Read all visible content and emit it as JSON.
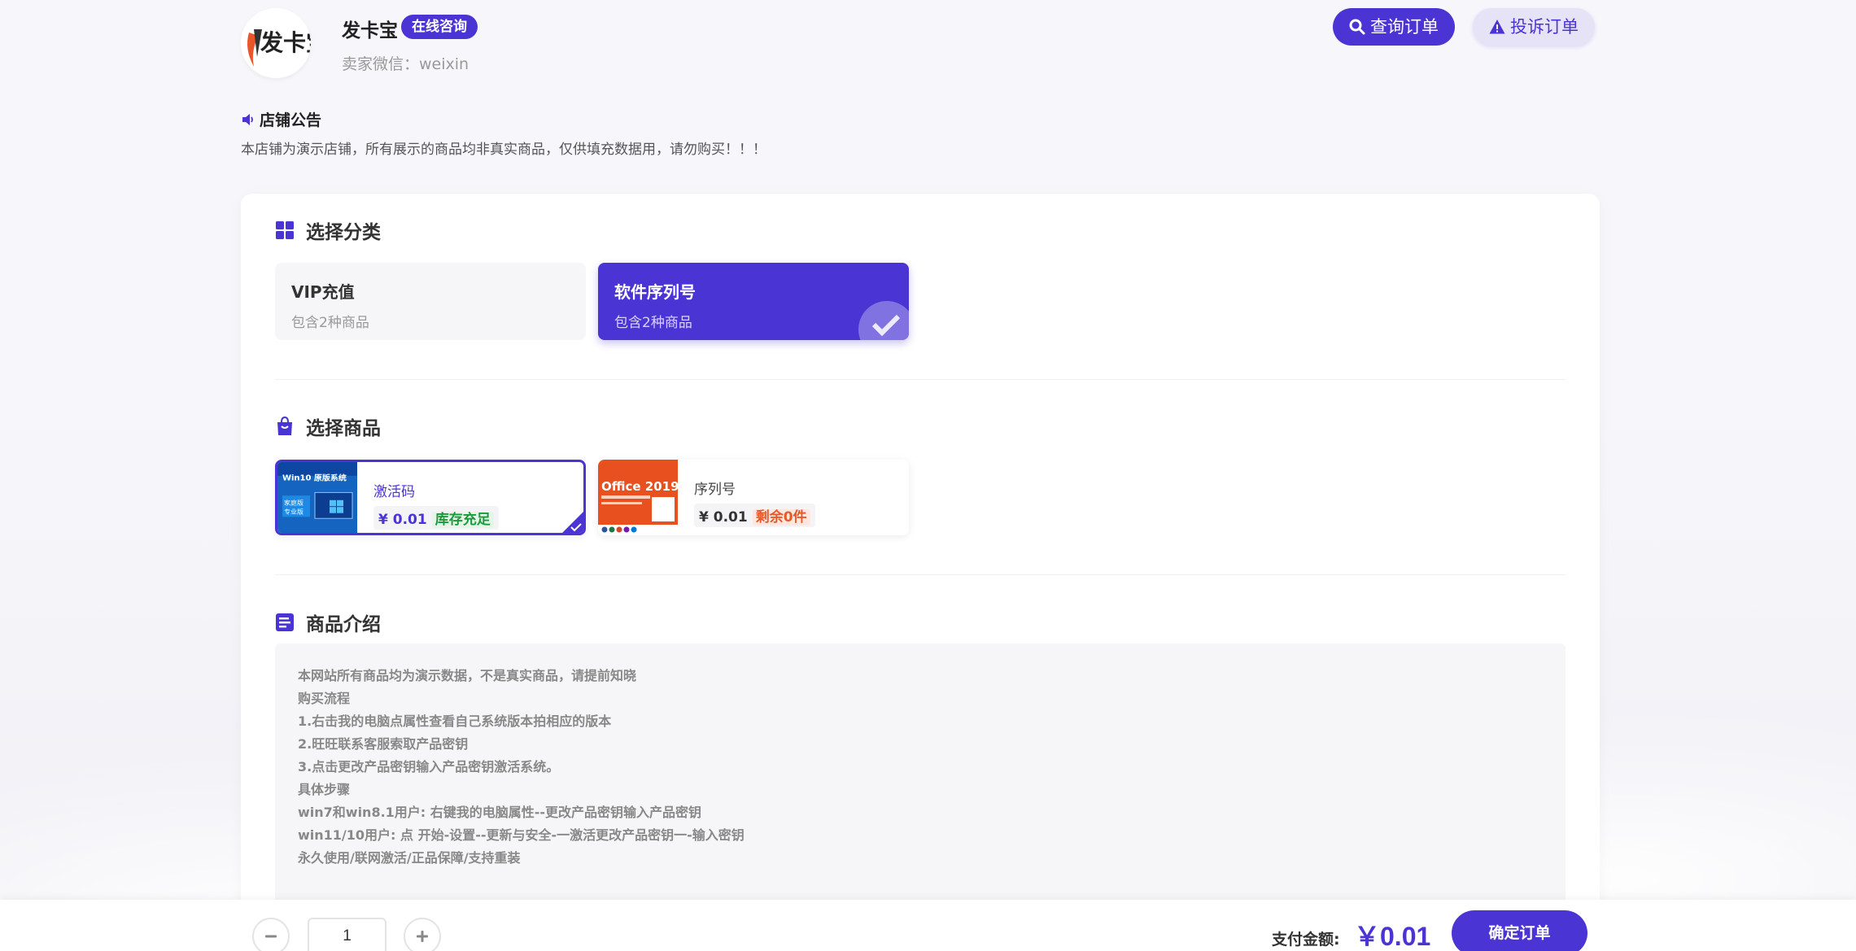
{
  "header": {
    "shop_name": "发卡宝",
    "consult_badge": "在线咨询",
    "seller_line": "卖家微信：weixin",
    "query_button": "查询订单",
    "complain_button": "投诉订单",
    "logo_text": "发卡宝"
  },
  "notice": {
    "title": "店铺公告",
    "text": "本店铺为演示店铺，所有展示的商品均非真实商品，仅供填充数据用，请勿购买！！！"
  },
  "categories": {
    "title": "选择分类",
    "items": [
      {
        "name": "VIP充值",
        "count": "包含2种商品",
        "active": false
      },
      {
        "name": "软件序列号",
        "count": "包含2种商品",
        "active": true
      }
    ]
  },
  "goods": {
    "title": "选择商品",
    "items": [
      {
        "name": "激活码",
        "price": "¥ 0.01",
        "stock": "库存充足",
        "thumb_title": "Win10 原版系统",
        "thumb_sub": "家庭版 专业版",
        "active": true
      },
      {
        "name": "序列号",
        "price": "¥ 0.01",
        "stock": "剩余0件",
        "thumb_title": "Office 2019",
        "active": false
      }
    ]
  },
  "intro": {
    "title": "商品介绍",
    "lines": [
      "本网站所有商品均为演示数据，不是真实商品，请提前知晓",
      "购买流程",
      "1.右击我的电脑点属性查看自己系统版本拍相应的版本",
      "2.旺旺联系客服索取产品密钥",
      "3.点击更改产品密钥输入产品密钥激活系统。",
      "具体步骤",
      "win7和win8.1用户: 右键我的电脑属性--更改产品密钥输入产品密钥",
      "win11/10用户: 点 开始-设置--更新与安全-一激活更改产品密钥一-输入密钥",
      "永久使用/联网激活/正品保障/支持重装"
    ]
  },
  "bottom": {
    "quantity": "1",
    "pay_label": "支付金额:",
    "pay_amount": "￥0.01",
    "confirm_button": "确定订单"
  },
  "colors": {
    "accent": "#4a35d4",
    "stock_ok": "#1a9a3a",
    "stock_low": "#e55a2c"
  }
}
